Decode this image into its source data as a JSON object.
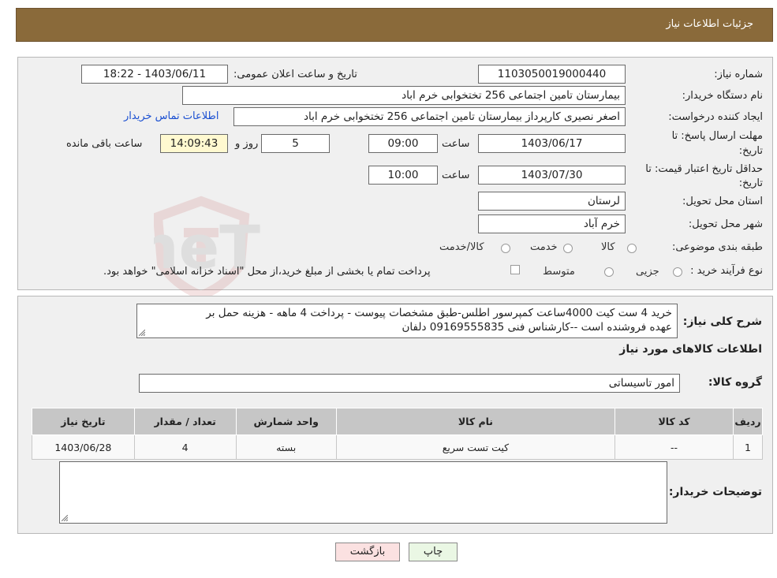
{
  "header": {
    "title": "جزئیات اطلاعات نیاز"
  },
  "form": {
    "need_number_label": "شماره نیاز:",
    "need_number": "1103050019000440",
    "announce_datetime_label": "تاریخ و ساعت اعلان عمومی:",
    "announce_datetime": "1403/06/11 - 18:22",
    "buyer_org_label": "نام دستگاه خریدار:",
    "buyer_org": "بیمارستان تامین اجتماعی  256 تختخوابی خرم اباد",
    "requester_label": "ایجاد کننده درخواست:",
    "requester": "اصغر نصیری کارپرداز بیمارستان تامین اجتماعی  256 تختخوابی خرم اباد",
    "contact_link": "اطلاعات تماس خریدار",
    "reply_deadline_label_1": "مهلت ارسال پاسخ: تا",
    "reply_deadline_label_2": "تاریخ:",
    "reply_date": "1403/06/17",
    "hour_label": "ساعت",
    "reply_time": "09:00",
    "days": "5",
    "days_label": "روز و",
    "remaining_time": "14:09:43",
    "remaining_label": "ساعت باقی مانده",
    "price_validity_label_1": "حداقل تاریخ اعتبار قیمت: تا",
    "price_validity_label_2": "تاریخ:",
    "validity_date": "1403/07/30",
    "validity_time": "10:00",
    "province_label": "استان محل تحویل:",
    "province": "لرستان",
    "city_label": "شهر محل تحویل:",
    "city": "خرم آباد",
    "category_label": "طبقه بندی موضوعی:",
    "category_options": [
      "کالا",
      "خدمت",
      "کالا/خدمت"
    ],
    "purchase_type_label": "نوع فرآیند خرید :",
    "purchase_options": [
      "جزیی",
      "متوسط"
    ],
    "purchase_note": "پرداخت تمام یا بخشی از مبلغ خرید،از محل \"اسناد خزانه اسلامی\" خواهد بود."
  },
  "watermark": {
    "text": "AriaTender.neT"
  },
  "details": {
    "summary_label": "شرح کلی نیاز:",
    "summary_line1": "خرید 4 ست کیت 4000ساعت کمپرسور اطلس-طبق مشخصات پیوست - پرداخت 4 ماهه - هزینه حمل بر",
    "summary_line2": "عهده فروشنده است --کارشناس فنی 09169555835 دلفان",
    "goods_info_title": "اطلاعات کالاهای مورد نیاز",
    "goods_group_label": "گروه کالا:",
    "goods_group": "امور تاسیساتی",
    "table": {
      "headers": [
        "ردیف",
        "کد کالا",
        "نام کالا",
        "واحد شمارش",
        "تعداد / مقدار",
        "تاریخ نیاز"
      ],
      "rows": [
        [
          "1",
          "--",
          "کیت تست سریع",
          "بسته",
          "4",
          "1403/06/28"
        ]
      ]
    },
    "buyer_notes_label": "توضیحات خریدار:"
  },
  "buttons": {
    "print": "چاپ",
    "back": "بازگشت"
  },
  "colors": {
    "header_bg": "#8a6a3a",
    "panel_bg": "#f0f0f0",
    "highlight": "#fff9d0",
    "link": "#1a4fd1",
    "back_btn": "#fbe1e1",
    "print_btn": "#eaf7e4"
  }
}
